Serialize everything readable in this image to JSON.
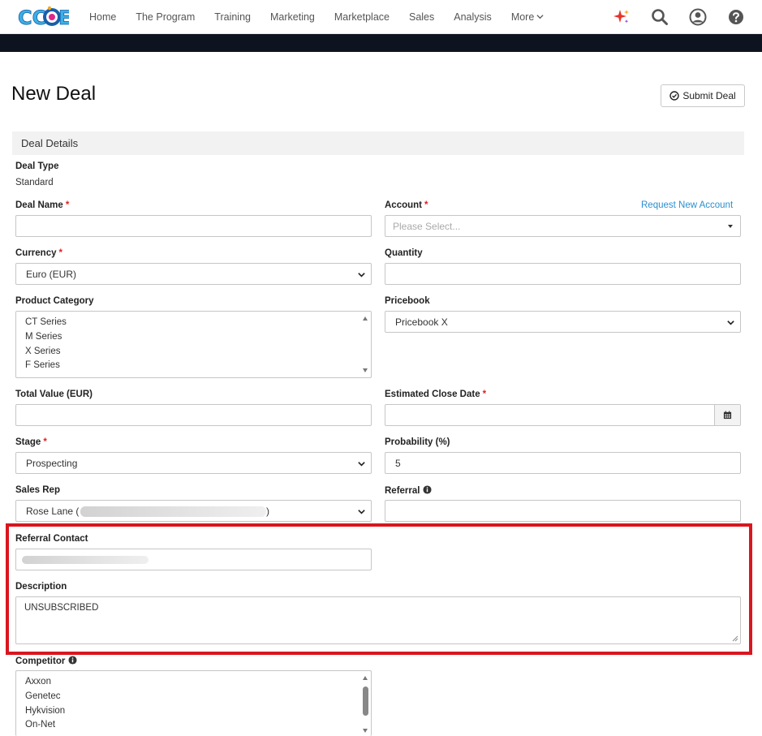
{
  "nav": {
    "logo_text": "CCOE",
    "links": [
      "Home",
      "The Program",
      "Training",
      "Marketing",
      "Marketplace",
      "Sales",
      "Analysis",
      "More"
    ],
    "icons": [
      "sparkle-icon",
      "search-icon",
      "user-circle-icon",
      "help-icon"
    ]
  },
  "page": {
    "title": "New Deal",
    "submit_label": "Submit Deal",
    "section_title": "Deal Details"
  },
  "form": {
    "deal_type": {
      "label": "Deal Type",
      "value": "Standard"
    },
    "deal_name": {
      "label": "Deal Name",
      "required": "*",
      "value": ""
    },
    "account": {
      "label": "Account",
      "required": "*",
      "placeholder": "Please Select...",
      "link": "Request New Account"
    },
    "currency": {
      "label": "Currency",
      "required": "*",
      "value": "Euro (EUR)"
    },
    "quantity": {
      "label": "Quantity",
      "value": ""
    },
    "product_category": {
      "label": "Product Category",
      "options": [
        "CT Series",
        "M Series",
        "X Series",
        "F Series"
      ]
    },
    "pricebook": {
      "label": "Pricebook",
      "value": "Pricebook X"
    },
    "total_value": {
      "label": "Total Value (EUR)",
      "value": ""
    },
    "close_date": {
      "label": "Estimated Close Date",
      "required": "*",
      "value": ""
    },
    "stage": {
      "label": "Stage",
      "required": "*",
      "value": "Prospecting"
    },
    "probability": {
      "label": "Probability (%)",
      "value": "5"
    },
    "sales_rep": {
      "label": "Sales Rep",
      "value_prefix": "Rose Lane (",
      "value_suffix": ")"
    },
    "referral": {
      "label": "Referral",
      "value": ""
    },
    "referral_contact": {
      "label": "Referral Contact"
    },
    "description": {
      "label": "Description",
      "value": "UNSUBSCRIBED"
    },
    "competitor": {
      "label": "Competitor",
      "options": [
        "Axxon",
        "Genetec",
        "Hykvision",
        "On-Net"
      ]
    }
  },
  "colors": {
    "highlight": "#d9161f",
    "link": "#2a8fd0",
    "required": "#dd2222",
    "dark_bar": "#0d1420"
  }
}
